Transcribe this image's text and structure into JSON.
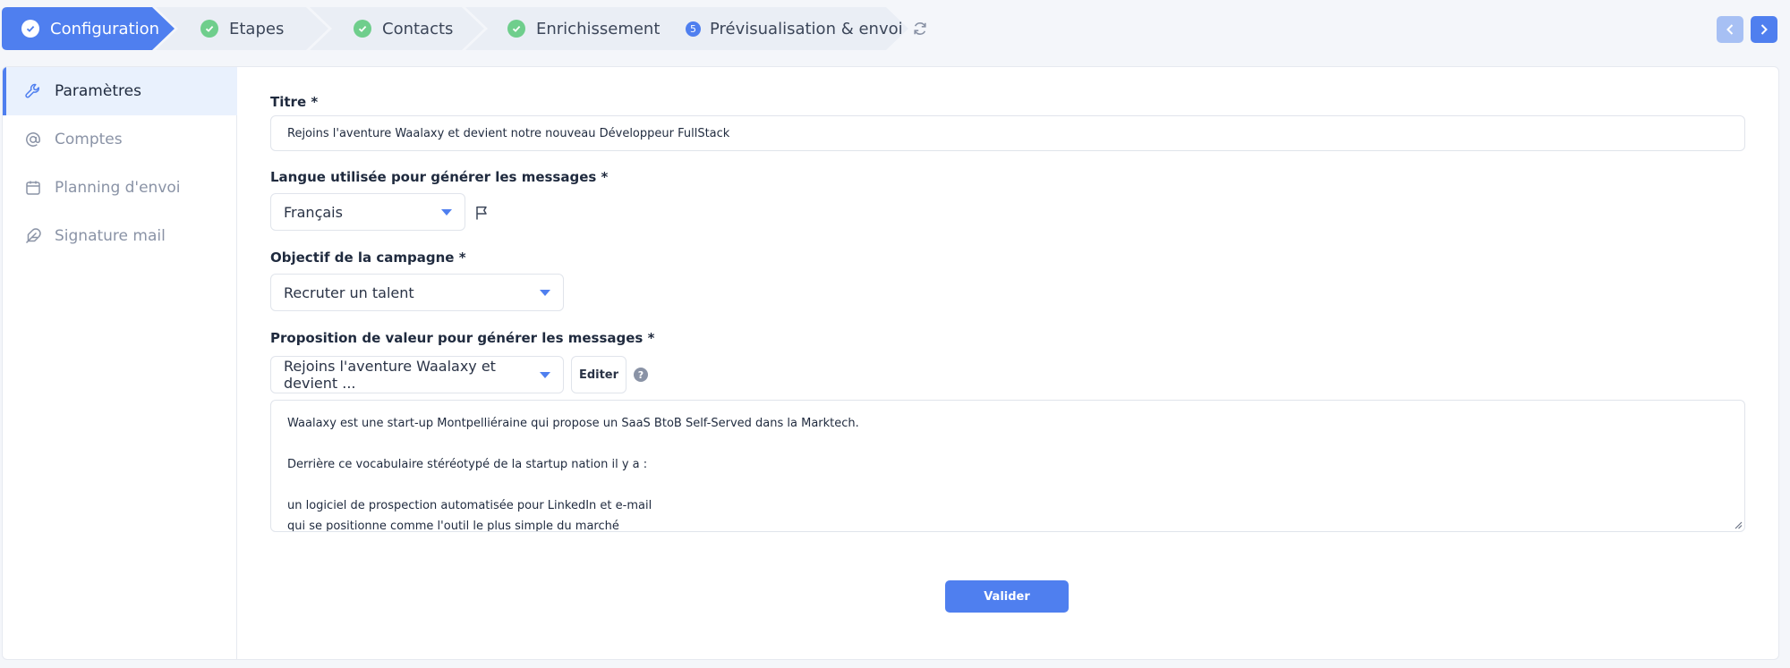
{
  "stepper": {
    "steps": [
      {
        "label": "Configuration"
      },
      {
        "label": "Etapes"
      },
      {
        "label": "Contacts"
      },
      {
        "label": "Enrichissement"
      },
      {
        "label": "Prévisualisation & envoi",
        "number": "5"
      }
    ]
  },
  "sidebar": {
    "items": [
      {
        "label": "Paramètres",
        "icon": "wrench-icon"
      },
      {
        "label": "Comptes",
        "icon": "at-sign-icon"
      },
      {
        "label": "Planning d'envoi",
        "icon": "calendar-icon"
      },
      {
        "label": "Signature mail",
        "icon": "feather-icon"
      }
    ]
  },
  "form": {
    "title_label": "Titre *",
    "title_value": "Rejoins l'aventure Waalaxy et devient notre nouveau Développeur FullStack",
    "language_label": "Langue utilisée pour générer les messages *",
    "language_value": "Français",
    "objective_label": "Objectif de la campagne *",
    "objective_value": "Recruter un talent",
    "value_prop_label": "Proposition de valeur pour générer les messages *",
    "value_prop_value": "Rejoins l'aventure Waalaxy et devient ...",
    "edit_label": "Editer",
    "help_glyph": "?",
    "textarea_lines": [
      "Waalaxy est une start-up Montpelliéraine qui propose un SaaS BtoB Self-Served dans la Marktech.",
      "",
      "Derrière ce vocabulaire stéréotypé de la startup nation il y a :",
      "",
      "un logiciel de prospection automatisée pour LinkedIn et e-mail",
      "qui se positionne comme l'outil le plus simple du marché"
    ],
    "submit_label": "Valider"
  },
  "colors": {
    "accent": "#4f7fef",
    "accent_light": "#a7c0f4",
    "success": "#6fce8c",
    "active_bg": "#e9f1fd"
  }
}
